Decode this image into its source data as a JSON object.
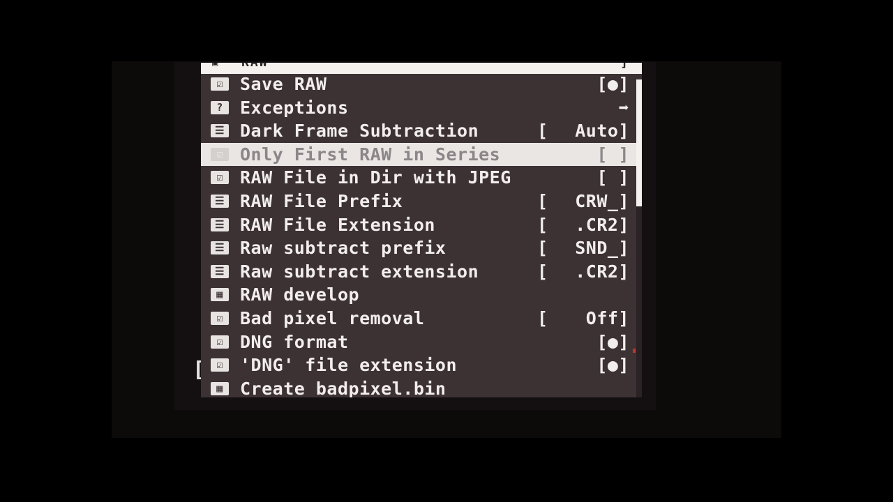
{
  "menu_title": {
    "icon": "raw-icon",
    "text": "RAW",
    "value": "]"
  },
  "items": [
    {
      "icon": "checkbox-icon",
      "icon_glyph": "☑",
      "label": "Save RAW",
      "bracket": "",
      "value": "[●]"
    },
    {
      "icon": "help-icon",
      "icon_glyph": "?",
      "label": "Exceptions",
      "bracket": "",
      "value": "➡"
    },
    {
      "icon": "list-icon",
      "icon_glyph": "☰",
      "label": "Dark Frame Subtraction",
      "bracket": "[",
      "value": "Auto]"
    },
    {
      "icon": "checkbox-icon",
      "icon_glyph": "☑",
      "label": "Only First RAW in Series",
      "bracket": "",
      "value": "[ ]",
      "selected": true
    },
    {
      "icon": "checkbox-icon",
      "icon_glyph": "☑",
      "label": "RAW File in Dir with JPEG",
      "bracket": "",
      "value": "[ ]"
    },
    {
      "icon": "list-icon",
      "icon_glyph": "☰",
      "label": "RAW File Prefix",
      "bracket": "[",
      "value": "CRW_]"
    },
    {
      "icon": "list-icon",
      "icon_glyph": "☰",
      "label": "RAW File Extension",
      "bracket": "[",
      "value": ".CR2]"
    },
    {
      "icon": "list-icon",
      "icon_glyph": "☰",
      "label": "Raw subtract prefix",
      "bracket": "[",
      "value": "SND_]"
    },
    {
      "icon": "list-icon",
      "icon_glyph": "☰",
      "label": "Raw subtract extension",
      "bracket": "[",
      "value": ".CR2]"
    },
    {
      "icon": "submenu-icon",
      "icon_glyph": "▦",
      "label": "RAW develop",
      "bracket": "",
      "value": ""
    },
    {
      "icon": "checkbox-icon",
      "icon_glyph": "☑",
      "label": "Bad pixel removal",
      "bracket": "[",
      "value": "Off]"
    },
    {
      "icon": "checkbox-icon",
      "icon_glyph": "☑",
      "label": "DNG format",
      "bracket": "",
      "value": "[●]"
    },
    {
      "icon": "checkbox-icon",
      "icon_glyph": "☑",
      "label": "'DNG' file extension",
      "bracket": "",
      "value": "[●]"
    },
    {
      "icon": "submenu-icon",
      "icon_glyph": "▦",
      "label": "Create badpixel.bin",
      "bracket": "",
      "value": ""
    }
  ],
  "left_edge_glyph": "[",
  "colors": {
    "menu_bg": "#3c3234",
    "text": "#f2eeec",
    "highlight_bg": "#e9e6e4",
    "highlight_text": "#8c8688"
  }
}
